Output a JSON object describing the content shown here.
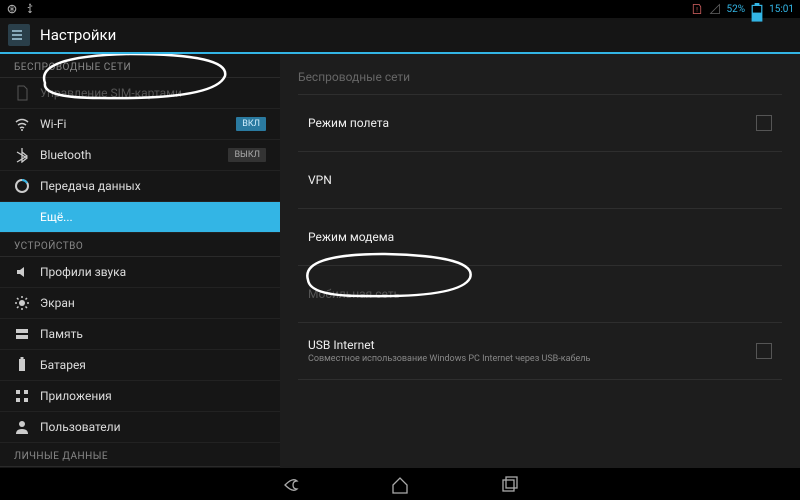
{
  "statusbar": {
    "battery": "52%",
    "time": "15:01"
  },
  "actionbar": {
    "title": "Настройки"
  },
  "sidebar": {
    "section_wireless": "БЕСПРОВОДНЫЕ СЕТИ",
    "section_device": "УСТРОЙСТВО",
    "section_personal": "ЛИЧНЫЕ ДАННЫЕ",
    "items": {
      "sim": "Управление SIM-картами",
      "wifi": "Wi-Fi",
      "bt": "Bluetooth",
      "data": "Передача данных",
      "more": "Ещё...",
      "sound": "Профили звука",
      "display": "Экран",
      "storage": "Память",
      "battery": "Батарея",
      "apps": "Приложения",
      "users": "Пользователи"
    },
    "toggles": {
      "on": "ВКЛ",
      "off": "ВЫКЛ"
    }
  },
  "content": {
    "header": "Беспроводные сети",
    "airplane": "Режим полета",
    "vpn": "VPN",
    "tether": "Режим модема",
    "mobile": "Мобильная сеть",
    "usb_title": "USB Internet",
    "usb_sub": "Совместное использование Windows PC Internet через USB-кабель"
  }
}
